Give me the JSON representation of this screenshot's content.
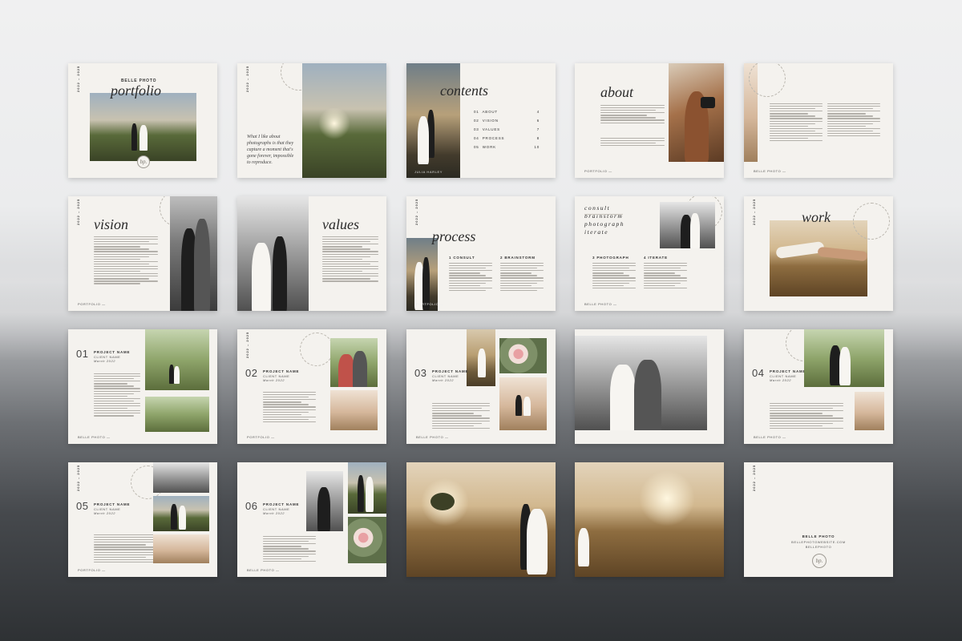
{
  "years": "2022 – 2025",
  "footer_portfolio": "PORTFOLIO —",
  "footer_belle": "BELLE PHOTO —",
  "stamp_text": "bp.",
  "ring_text": "PORTFOLIO",
  "cover": {
    "brand": "BELLE PHOTO",
    "title": "portfolio"
  },
  "intro": {
    "quote": "What I like about photographs is that they capture a moment that's gone forever, impossible to reproduce."
  },
  "contents": {
    "title": "contents",
    "caption": "JULIA HARLEY",
    "items": [
      {
        "num": "01",
        "label": "ABOUT",
        "page": "4"
      },
      {
        "num": "02",
        "label": "VISION",
        "page": "6"
      },
      {
        "num": "03",
        "label": "VALUES",
        "page": "7"
      },
      {
        "num": "04",
        "label": "PROCESS",
        "page": "8"
      },
      {
        "num": "05",
        "label": "WORK",
        "page": "10"
      }
    ]
  },
  "about": {
    "title": "about"
  },
  "vision": {
    "title": "vision"
  },
  "values": {
    "title": "values"
  },
  "process": {
    "title": "process",
    "steps": [
      "1 CONSULT",
      "2 BRAINSTORM"
    ]
  },
  "process2": {
    "words": [
      "consult",
      "brainstorm",
      "photograph",
      "iterate"
    ],
    "steps": [
      "3 PHOTOGRAPH",
      "4 ITERATE"
    ]
  },
  "work": {
    "title": "work"
  },
  "projects": [
    {
      "num": "01",
      "name": "PROJECT NAME",
      "client": "CLIENT NAME",
      "date": "March 2022"
    },
    {
      "num": "02",
      "name": "PROJECT NAME",
      "client": "CLIENT NAME",
      "date": "March 2022"
    },
    {
      "num": "03",
      "name": "PROJECT NAME",
      "client": "CLIENT NAME",
      "date": "March 2022"
    },
    {
      "num": "04",
      "name": "PROJECT NAME",
      "client": "CLIENT NAME",
      "date": "March 2022"
    },
    {
      "num": "05",
      "name": "PROJECT NAME",
      "client": "CLIENT NAME",
      "date": "March 2022"
    },
    {
      "num": "06",
      "name": "PROJECT NAME",
      "client": "CLIENT NAME",
      "date": "March 2022"
    }
  ],
  "closing": {
    "brand": "BELLE PHOTO",
    "website": "BELLEPHOTOWEBSITE.COM",
    "handle": "BELLEPHOTO"
  }
}
